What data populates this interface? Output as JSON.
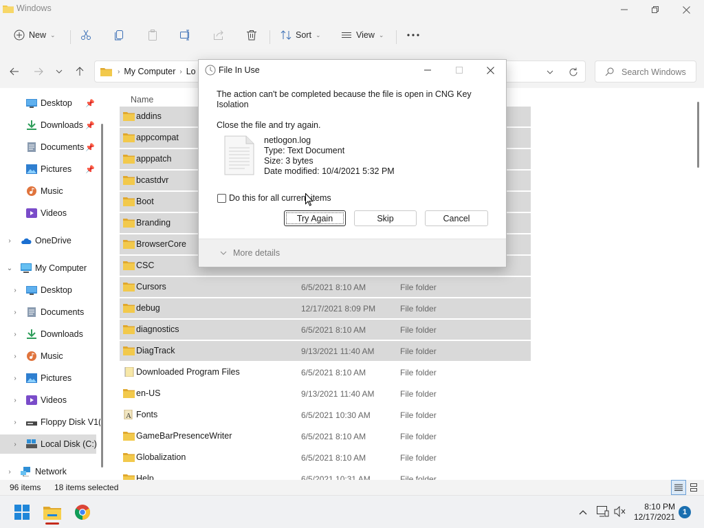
{
  "window": {
    "title": "Windows",
    "controls": [
      "minimize",
      "maximize",
      "close"
    ]
  },
  "toolbar": {
    "new_label": "New",
    "sort_label": "Sort",
    "view_label": "View",
    "icons": [
      "cut-icon",
      "copy-icon",
      "paste-icon",
      "rename-icon",
      "share-icon",
      "delete-icon",
      "more-icon"
    ]
  },
  "address": {
    "crumbs": [
      "My Computer",
      "Lo"
    ],
    "search_placeholder": "Search Windows"
  },
  "nav": {
    "items": [
      {
        "label": "Desktop",
        "icon": "desktop-icon",
        "pinned": true
      },
      {
        "label": "Downloads",
        "icon": "download-icon",
        "pinned": true
      },
      {
        "label": "Documents",
        "icon": "documents-icon",
        "pinned": true
      },
      {
        "label": "Pictures",
        "icon": "pictures-icon",
        "pinned": true
      },
      {
        "label": "Music",
        "icon": "music-icon",
        "pinned": false
      },
      {
        "label": "Videos",
        "icon": "videos-icon",
        "pinned": false
      },
      {
        "label": "OneDrive",
        "icon": "cloud-icon"
      },
      {
        "label": "My Computer",
        "icon": "computer-icon"
      },
      {
        "label": "Desktop",
        "icon": "desktop-icon"
      },
      {
        "label": "Documents",
        "icon": "documents-icon"
      },
      {
        "label": "Downloads",
        "icon": "download-icon"
      },
      {
        "label": "Music",
        "icon": "music-icon"
      },
      {
        "label": "Pictures",
        "icon": "pictures-icon"
      },
      {
        "label": "Videos",
        "icon": "videos-icon"
      },
      {
        "label": "Floppy Disk V1(",
        "icon": "floppy-icon"
      },
      {
        "label": "Local Disk (C:)",
        "icon": "drive-icon"
      },
      {
        "label": "Network",
        "icon": "network-icon"
      }
    ]
  },
  "filelist": {
    "col_name": "Name",
    "rows": [
      {
        "name": "addins",
        "date": "",
        "type": "",
        "selected": true,
        "icon": "folder-icon"
      },
      {
        "name": "appcompat",
        "date": "",
        "type": "",
        "selected": true,
        "icon": "folder-icon"
      },
      {
        "name": "apppatch",
        "date": "",
        "type": "",
        "selected": true,
        "icon": "folder-icon"
      },
      {
        "name": "bcastdvr",
        "date": "",
        "type": "",
        "selected": true,
        "icon": "folder-icon"
      },
      {
        "name": "Boot",
        "date": "",
        "type": "",
        "selected": true,
        "icon": "folder-icon"
      },
      {
        "name": "Branding",
        "date": "",
        "type": "",
        "selected": true,
        "icon": "folder-icon"
      },
      {
        "name": "BrowserCore",
        "date": "",
        "type": "",
        "selected": true,
        "icon": "folder-icon"
      },
      {
        "name": "CSC",
        "date": "",
        "type": "",
        "selected": true,
        "icon": "folder-icon"
      },
      {
        "name": "Cursors",
        "date": "6/5/2021 8:10 AM",
        "type": "File folder",
        "selected": true,
        "icon": "folder-icon"
      },
      {
        "name": "debug",
        "date": "12/17/2021 8:09 PM",
        "type": "File folder",
        "selected": true,
        "icon": "folder-icon"
      },
      {
        "name": "diagnostics",
        "date": "6/5/2021 8:10 AM",
        "type": "File folder",
        "selected": true,
        "icon": "folder-icon"
      },
      {
        "name": "DiagTrack",
        "date": "9/13/2021 11:40 AM",
        "type": "File folder",
        "selected": true,
        "icon": "folder-icon"
      },
      {
        "name": "Downloaded Program Files",
        "date": "6/5/2021 8:10 AM",
        "type": "File folder",
        "selected": false,
        "icon": "special-folder-icon"
      },
      {
        "name": "en-US",
        "date": "9/13/2021 11:40 AM",
        "type": "File folder",
        "selected": false,
        "icon": "folder-icon"
      },
      {
        "name": "Fonts",
        "date": "6/5/2021 10:30 AM",
        "type": "File folder",
        "selected": false,
        "icon": "fonts-folder-icon"
      },
      {
        "name": "GameBarPresenceWriter",
        "date": "6/5/2021 8:10 AM",
        "type": "File folder",
        "selected": false,
        "icon": "folder-icon"
      },
      {
        "name": "Globalization",
        "date": "6/5/2021 8:10 AM",
        "type": "File folder",
        "selected": false,
        "icon": "folder-icon"
      },
      {
        "name": "Help",
        "date": "6/5/2021 10:31 AM",
        "type": "File folder",
        "selected": false,
        "icon": "folder-icon"
      }
    ]
  },
  "status": {
    "items_count": "96 items",
    "selected_count": "18 items selected"
  },
  "dialog": {
    "title": "File In Use",
    "message": "The action can't be completed because the file is open in CNG Key Isolation",
    "instruction": "Close the file and try again.",
    "file_name": "netlogon.log",
    "file_type": "Type: Text Document",
    "file_size": "Size: 3 bytes",
    "file_modified": "Date modified: 10/4/2021 5:32 PM",
    "checkbox_label": "Do this for all current items",
    "checkbox_checked": false,
    "try_again_label": "Try Again",
    "skip_label": "Skip",
    "cancel_label": "Cancel",
    "more_details_label": "More details"
  },
  "taskbar": {
    "time": "8:10 PM",
    "date": "12/17/2021",
    "notification_count": "1",
    "apps": [
      "start-icon",
      "file-explorer-icon",
      "chrome-icon"
    ]
  },
  "colors": {
    "folder": "#f2c94c",
    "folder_dark": "#e0a82e",
    "selection": "#d9d9d9",
    "accent": "#1a6fb0"
  }
}
